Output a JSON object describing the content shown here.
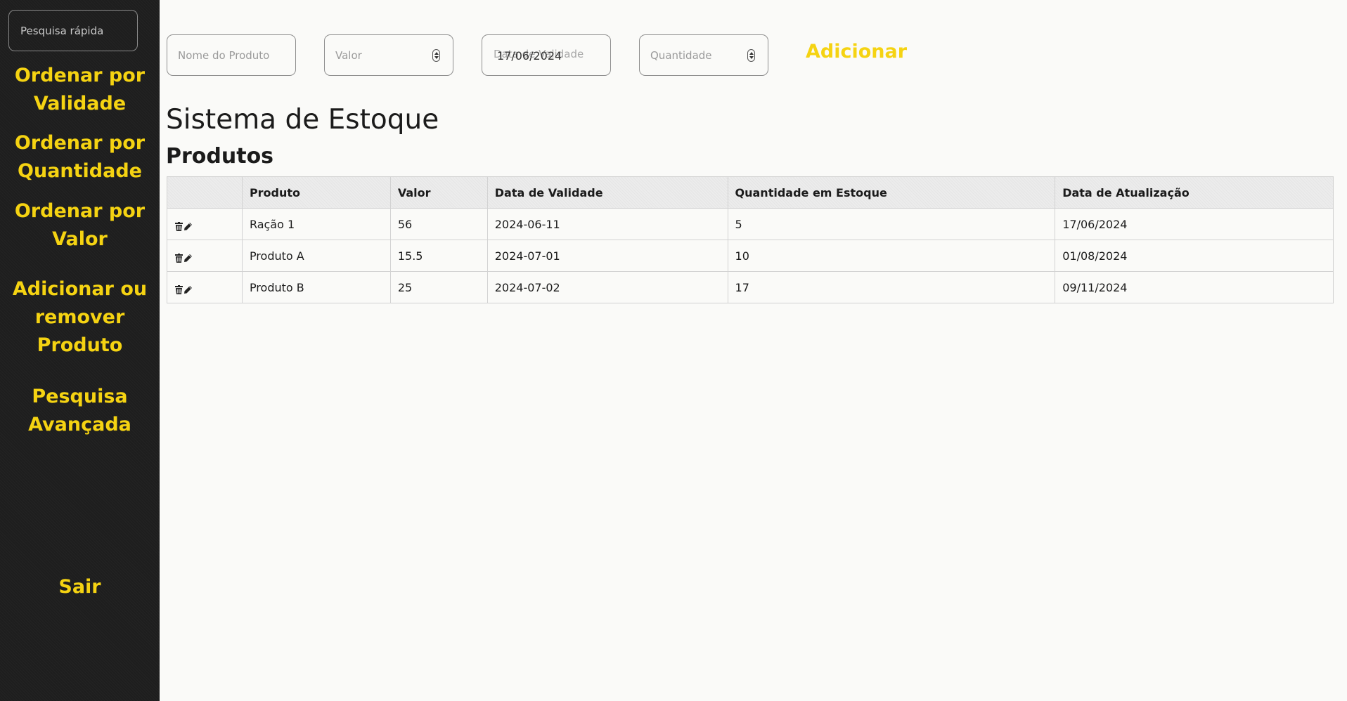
{
  "sidebar": {
    "search_placeholder": "Pesquisa rápida",
    "items": [
      {
        "label": "Ordenar por\nValidade"
      },
      {
        "label": "Ordenar por\nQuantidade"
      },
      {
        "label": "Ordenar por\nValor"
      },
      {
        "label": "Adicionar ou\nremover\nProduto"
      },
      {
        "label": "Pesquisa\nAvançada"
      },
      {
        "label": "Sair"
      }
    ]
  },
  "form": {
    "name_placeholder": "Nome do Produto",
    "value_placeholder": "Valor",
    "date_placeholder": "Data de Validade",
    "date_value": "17/06/2024",
    "quantity_placeholder": "Quantidade",
    "add_label": "Adicionar"
  },
  "page": {
    "title": "Sistema de Estoque",
    "section_title": "Produtos"
  },
  "table": {
    "headers": [
      "",
      "Produto",
      "Valor",
      "Data de Validade",
      "Quantidade em Estoque",
      "Data de Atualização"
    ],
    "rows": [
      {
        "produto": "Ração 1",
        "valor": "56",
        "validade": "2024-06-11",
        "quantidade": "5",
        "atualizacao": "17/06/2024"
      },
      {
        "produto": "Produto A",
        "valor": "15.5",
        "validade": "2024-07-01",
        "quantidade": "10",
        "atualizacao": "01/08/2024"
      },
      {
        "produto": "Produto B",
        "valor": "25",
        "validade": "2024-07-02",
        "quantidade": "17",
        "atualizacao": "09/11/2024"
      }
    ]
  },
  "colors": {
    "accent": "#f5d312",
    "sidebar_bg": "#1e1e1e",
    "page_bg": "#fafaf8"
  },
  "icons": {
    "delete": "trash-icon",
    "edit": "pencil-icon"
  }
}
